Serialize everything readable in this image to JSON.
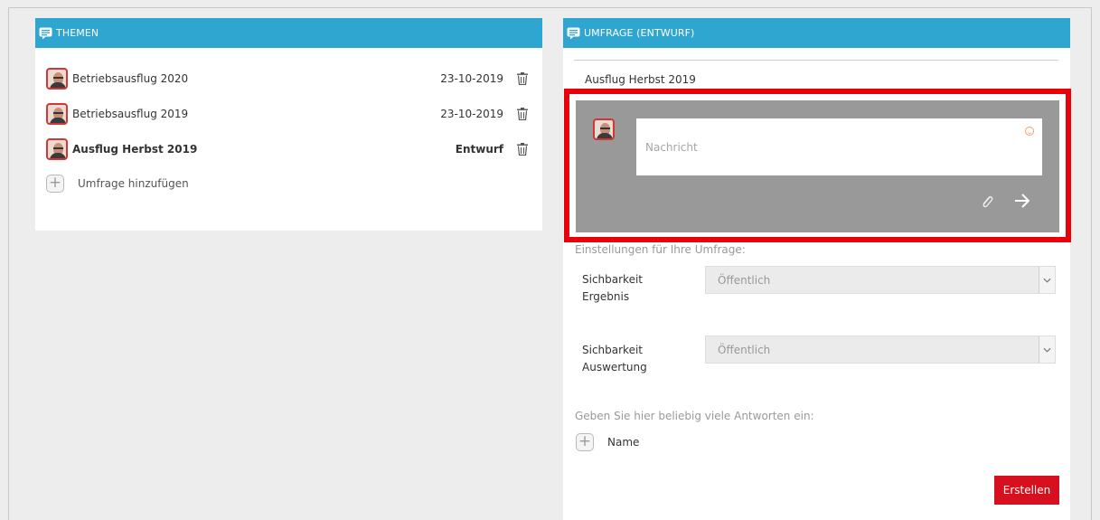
{
  "themen": {
    "header": "THEMEN",
    "topics": [
      {
        "title": "Betriebsausflug 2020",
        "date": "23-10-2019",
        "bold": false
      },
      {
        "title": "Betriebsausflug 2019",
        "date": "23-10-2019",
        "bold": false
      },
      {
        "title": "Ausflug Herbst 2019",
        "date": "Entwurf",
        "bold": true
      }
    ],
    "add_label": "Umfrage hinzufügen"
  },
  "umfrage": {
    "header": "UMFRAGE (ENTWURF)",
    "survey_name": "Ausflug Herbst 2019",
    "message_placeholder": "Nachricht",
    "settings_label": "Einstellungen für Ihre Umfrage:",
    "visibility_result_label": "Sichbarkeit Ergebnis",
    "visibility_result_value": "Öffentlich",
    "visibility_eval_label": "Sichbarkeit Auswertung",
    "visibility_eval_value": "Öffentlich",
    "answers_label": "Geben Sie hier beliebig viele Antworten ein:",
    "answer_placeholder": "Name",
    "create_label": "Erstellen"
  },
  "colors": {
    "header_blue": "#2fa6cf",
    "highlight_red": "#e8000b",
    "composer_gray": "#999999",
    "button_red": "#d6101e"
  },
  "icons": [
    "chat-bubble-icon",
    "trash-icon",
    "plus-icon",
    "smiley-icon",
    "paperclip-icon",
    "send-arrow-icon",
    "chevron-down-icon"
  ]
}
